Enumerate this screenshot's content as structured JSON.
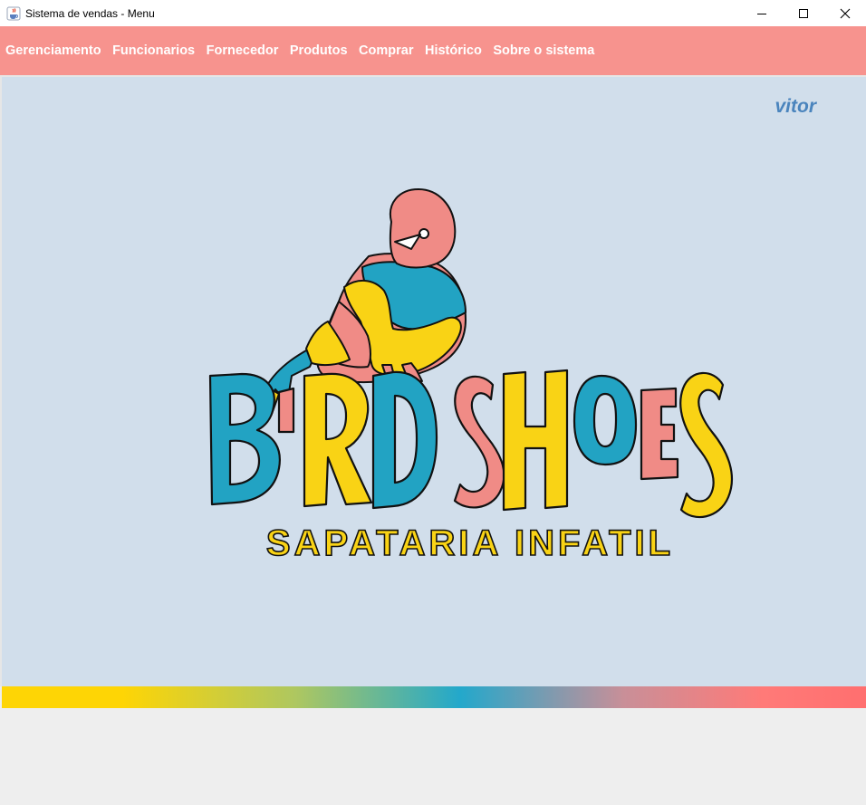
{
  "window": {
    "title": "Sistema de vendas - Menu",
    "controls": {
      "minimize": "minimize-icon",
      "maximize": "maximize-icon",
      "close": "close-icon"
    }
  },
  "menu": {
    "items": [
      {
        "label": "Gerenciamento"
      },
      {
        "label": "Funcionarios"
      },
      {
        "label": "Fornecedor"
      },
      {
        "label": "Produtos"
      },
      {
        "label": "Comprar"
      },
      {
        "label": "Histórico"
      },
      {
        "label": "Sobre o sistema"
      }
    ]
  },
  "user": {
    "name": "vitor"
  },
  "logo": {
    "brand": "BIRD SHOES",
    "subtitle": "SAPATARIA INFATIL"
  },
  "colors": {
    "menubar": "#f7938e",
    "content_bg": "#d1deeb",
    "user_name": "#4a84bd",
    "logo_blue": "#22a3c3",
    "logo_yellow": "#f9d315",
    "logo_pink": "#f08b86"
  }
}
